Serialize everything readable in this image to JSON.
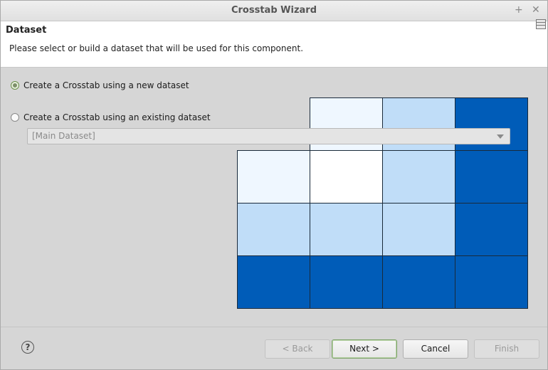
{
  "window": {
    "title": "Crosstab Wizard",
    "controls": [
      "+",
      "✕"
    ]
  },
  "header": {
    "title": "Dataset",
    "description": "Please select or build a dataset that will be used for this component."
  },
  "options": {
    "new_dataset": {
      "label": "Create a Crosstab using a new dataset",
      "checked": true
    },
    "existing_dataset": {
      "label": "Create a Crosstab using an existing dataset",
      "checked": false
    }
  },
  "dataset_combo": {
    "value": "[Main Dataset]",
    "enabled": false
  },
  "preview_colors": {
    "dark": "#005cb8",
    "light": "#c0ddf8",
    "pale": "#eff7ff",
    "white": "#ffffff"
  },
  "footer": {
    "help_symbol": "?",
    "back_label": "< Back",
    "next_label": "Next >",
    "cancel_label": "Cancel",
    "finish_label": "Finish"
  }
}
